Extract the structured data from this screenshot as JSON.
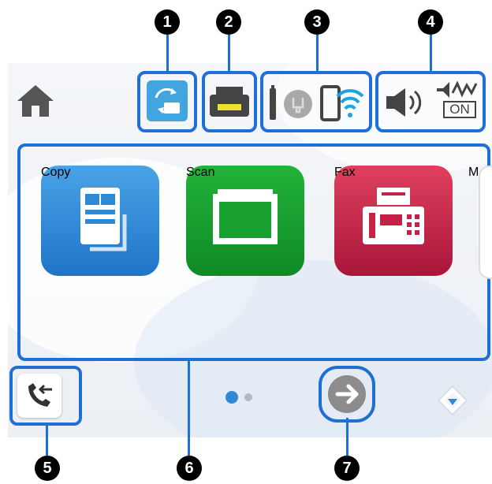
{
  "callouts": [
    "1",
    "2",
    "3",
    "4",
    "5",
    "6",
    "7"
  ],
  "apps": [
    {
      "label": "Copy",
      "icon": "copy-icon",
      "color": "#2f8ad6"
    },
    {
      "label": "Scan",
      "icon": "scan-icon",
      "color": "#17a02f"
    },
    {
      "label": "Fax",
      "icon": "fax-icon",
      "color": "#c62045"
    },
    {
      "label": "M",
      "icon": "more-icon",
      "color": "#ffffff"
    }
  ],
  "status": {
    "sound_badge": "ON"
  },
  "pagination": {
    "pages": 2,
    "current": 1
  },
  "colors": {
    "highlight": "#1f6fd6",
    "copy": "#2f8ad6",
    "scan": "#17a02f",
    "fax": "#c62045"
  }
}
